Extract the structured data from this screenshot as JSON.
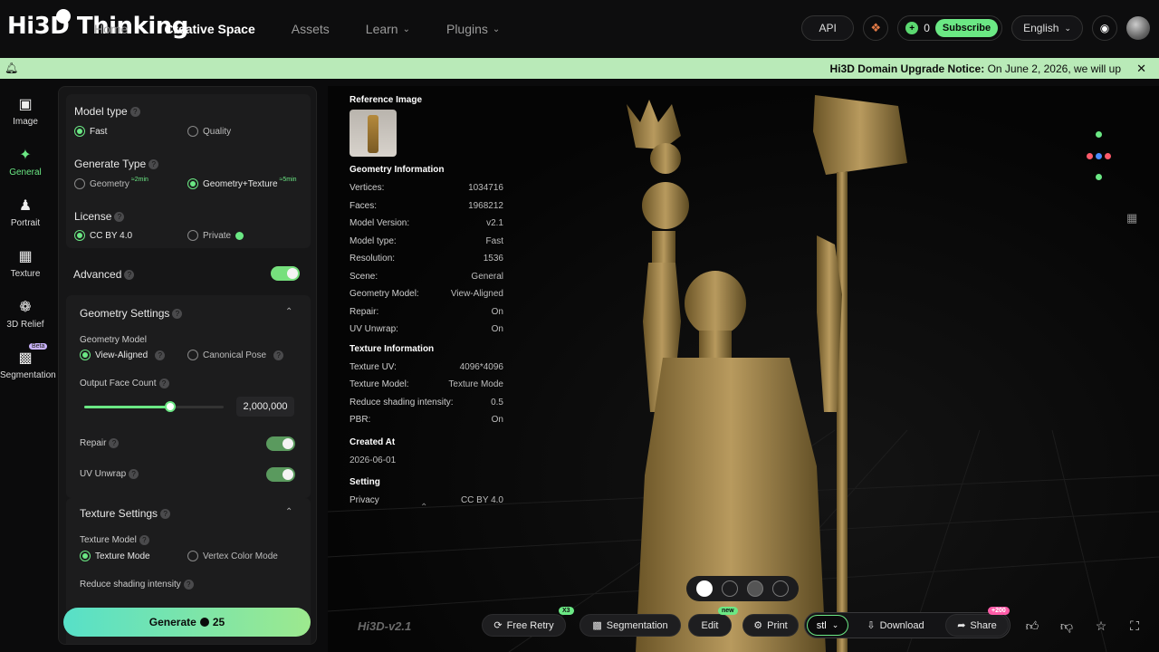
{
  "brand": {
    "logo_text": "Hi3D Thinking"
  },
  "nav": {
    "items": [
      {
        "label": "Home",
        "active": false,
        "dropdown": false
      },
      {
        "label": "Creative Space",
        "active": true,
        "dropdown": false
      },
      {
        "label": "Assets",
        "active": false,
        "dropdown": false
      },
      {
        "label": "Learn",
        "active": false,
        "dropdown": true
      },
      {
        "label": "Plugins",
        "active": false,
        "dropdown": true
      }
    ]
  },
  "top_right": {
    "api_label": "API",
    "credits": "0",
    "subscribe_label": "Subscribe",
    "language": "English"
  },
  "notice": {
    "title": "Hi3D Domain Upgrade Notice:",
    "text": "On June 2, 2026, we will up"
  },
  "left_nav": [
    {
      "label": "Image",
      "icon": "image-plus-icon"
    },
    {
      "label": "General",
      "icon": "sparkle-icon",
      "active": true
    },
    {
      "label": "Portrait",
      "icon": "portrait-icon"
    },
    {
      "label": "Texture",
      "icon": "texture-icon"
    },
    {
      "label": "3D Relief",
      "icon": "relief-icon"
    },
    {
      "label": "Segmentation",
      "icon": "segmentation-icon",
      "badge": "Beta"
    }
  ],
  "settings": {
    "model_type": {
      "label": "Model type",
      "options": [
        "Fast",
        "Quality"
      ],
      "selected": "Fast"
    },
    "generate_type": {
      "label": "Generate Type",
      "options": [
        "Geometry",
        "Geometry+Texture"
      ],
      "tags": [
        "≈2min",
        "≈5min"
      ],
      "selected": "Geometry+Texture"
    },
    "license": {
      "label": "License",
      "options": [
        "CC BY 4.0",
        "Private"
      ],
      "selected": "CC BY 4.0"
    },
    "advanced": {
      "label": "Advanced",
      "on": true
    },
    "geometry": {
      "title": "Geometry Settings",
      "model_label": "Geometry Model",
      "model_options": [
        "View-Aligned",
        "Canonical Pose"
      ],
      "model_selected": "View-Aligned",
      "face_count_label": "Output Face Count",
      "face_count": "2,000,000",
      "face_count_fraction": 0.62,
      "repair_label": "Repair",
      "repair_on": true,
      "uv_label": "UV Unwrap",
      "uv_on": true
    },
    "texture": {
      "title": "Texture Settings",
      "model_label": "Texture Model",
      "model_options": [
        "Texture Mode",
        "Vertex Color Mode"
      ],
      "model_selected": "Texture Mode",
      "shading_label": "Reduce shading intensity"
    },
    "generate": {
      "label": "Generate",
      "cost": "25"
    }
  },
  "info": {
    "reference_label": "Reference Image",
    "geometry_title": "Geometry Information",
    "geometry_rows": [
      {
        "k": "Vertices:",
        "v": "1034716"
      },
      {
        "k": "Faces:",
        "v": "1968212"
      },
      {
        "k": "Model Version:",
        "v": "v2.1"
      },
      {
        "k": "Model type:",
        "v": "Fast"
      },
      {
        "k": "Resolution:",
        "v": "1536"
      },
      {
        "k": "Scene:",
        "v": "General"
      },
      {
        "k": "Geometry Model:",
        "v": "View-Aligned"
      },
      {
        "k": "Repair:",
        "v": "On"
      },
      {
        "k": "UV Unwrap:",
        "v": "On"
      }
    ],
    "texture_title": "Texture Information",
    "texture_rows": [
      {
        "k": "Texture UV:",
        "v": "4096*4096"
      },
      {
        "k": "Texture Model:",
        "v": "Texture Mode"
      },
      {
        "k": "Reduce shading intensity:",
        "v": "0.5"
      },
      {
        "k": "PBR:",
        "v": "On"
      }
    ],
    "created_title": "Created At",
    "created_value": "2026-06-01",
    "setting_title": "Setting",
    "setting_rows": [
      {
        "k": "Privacy",
        "v": "CC BY 4.0"
      }
    ]
  },
  "viewer": {
    "watermark": "Hi3D-v2.1",
    "actions": {
      "free_retry": "Free Retry",
      "free_retry_badge": "X3",
      "segmentation": "Segmentation",
      "edit": "Edit",
      "edit_badge": "new",
      "print": "Print",
      "format": "stl",
      "download": "Download",
      "share": "Share",
      "share_badge": "+200"
    }
  }
}
